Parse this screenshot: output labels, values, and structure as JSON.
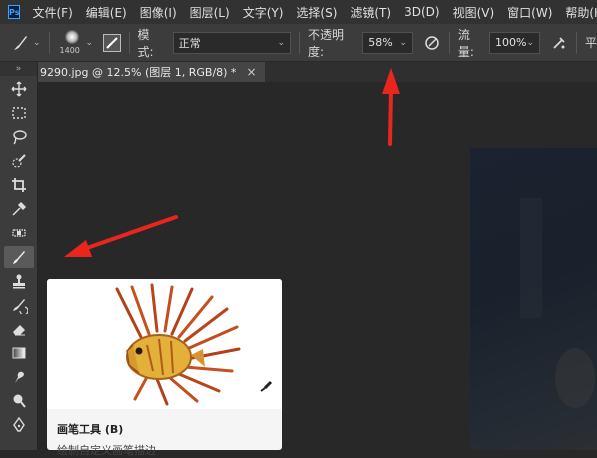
{
  "app": {
    "logo_text": "Ps"
  },
  "menu": [
    "文件(F)",
    "编辑(E)",
    "图像(I)",
    "图层(L)",
    "文字(Y)",
    "选择(S)",
    "滤镜(T)",
    "3D(D)",
    "视图(V)",
    "窗口(W)",
    "帮助(H)"
  ],
  "options": {
    "brush_size": "1400",
    "mode_label": "模式:",
    "mode_value": "正常",
    "opacity_label": "不透明度:",
    "opacity_value": "58%",
    "flow_label": "流量:",
    "flow_value": "100%",
    "smoothing_label": "平"
  },
  "document_tab": {
    "title": "9290.jpg @ 12.5% (图层 1, RGB/8) *",
    "close": "×"
  },
  "toolbar": {
    "grip": "»",
    "tools": [
      "move-tool",
      "marquee-tool",
      "lasso-tool",
      "quick-selection-tool",
      "crop-tool",
      "eyedropper-tool",
      "spot-healing-tool",
      "brush-tool",
      "clone-stamp-tool",
      "history-brush-tool",
      "eraser-tool",
      "gradient-tool",
      "smudge-tool",
      "dodge-tool",
      "pen-tool"
    ],
    "active_tool": "brush-tool"
  },
  "tooltip": {
    "title": "画笔工具 (B)",
    "description": "绘制自定义画笔描边"
  },
  "colors": {
    "annotation_arrow": "#e8261e",
    "accent": "#31a8ff"
  }
}
